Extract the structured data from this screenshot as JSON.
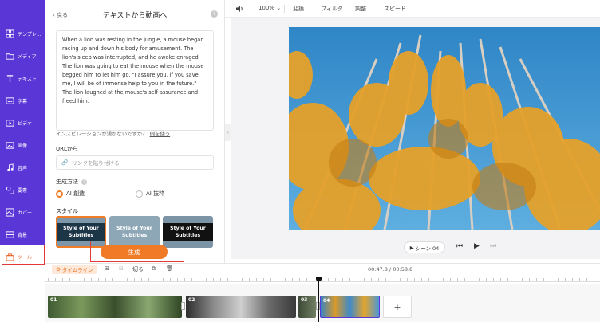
{
  "sidebar": {
    "items": [
      {
        "label": "テンプレ...",
        "icon": "template-icon"
      },
      {
        "label": "メディア",
        "icon": "folder-icon"
      },
      {
        "label": "テキスト",
        "icon": "text-icon"
      },
      {
        "label": "字幕",
        "icon": "subtitle-icon"
      },
      {
        "label": "ビデオ",
        "icon": "video-icon"
      },
      {
        "label": "画像",
        "icon": "image-icon"
      },
      {
        "label": "音声",
        "icon": "music-icon"
      },
      {
        "label": "要素",
        "icon": "elements-icon"
      },
      {
        "label": "カバー",
        "icon": "cover-icon"
      },
      {
        "label": "背景",
        "icon": "background-icon"
      },
      {
        "label": "ツール",
        "icon": "toolbox-icon"
      }
    ],
    "active_index": 10,
    "accent": "#5a36d6",
    "active_color": "#ee5b1f"
  },
  "panel": {
    "back_label": "戻る",
    "title": "テキストから動画へ",
    "story_text": "When a lion was resting in the jungle, a mouse began racing up and down his body for amusement. The lion's sleep was interrupted, and he awoke enraged. The lion was going to eat the mouse when the mouse begged him to let him go. \"I assure you, if you save me, I will be of immense help to you in the future.\" The lion laughed at the mouse's self-assurance and freed him.",
    "inspiration_text": "インスピレーションが湧かないですか？",
    "inspiration_link": "例を使う",
    "url_label": "URLから",
    "url_placeholder": "リンクを貼り付ける",
    "method_label": "生成方法",
    "method_options": [
      "AI 創造",
      "AI 抜粋"
    ],
    "method_selected": "AI 創造",
    "style_label": "スタイル",
    "style_cards": [
      "Style of Your Subtitles",
      "Style of Your Subtitles",
      "Style of Your Subtitles"
    ],
    "generate_label": "生成"
  },
  "toolbar": {
    "zoom": "100%",
    "transition": "変換",
    "filter": "フィルタ",
    "adjust": "調整",
    "speed": "スピード"
  },
  "player": {
    "scene_label": "シーン 04"
  },
  "timeline": {
    "label": "タイムライン",
    "split_label": "切る",
    "current_time": "00:47.8",
    "total_time": "00:58.8",
    "time_separator": "/",
    "clips": [
      "01",
      "02",
      "03",
      "04"
    ],
    "add_label": "+"
  },
  "colors": {
    "orange": "#f07a26",
    "highlight_red": "#e23a3a"
  }
}
